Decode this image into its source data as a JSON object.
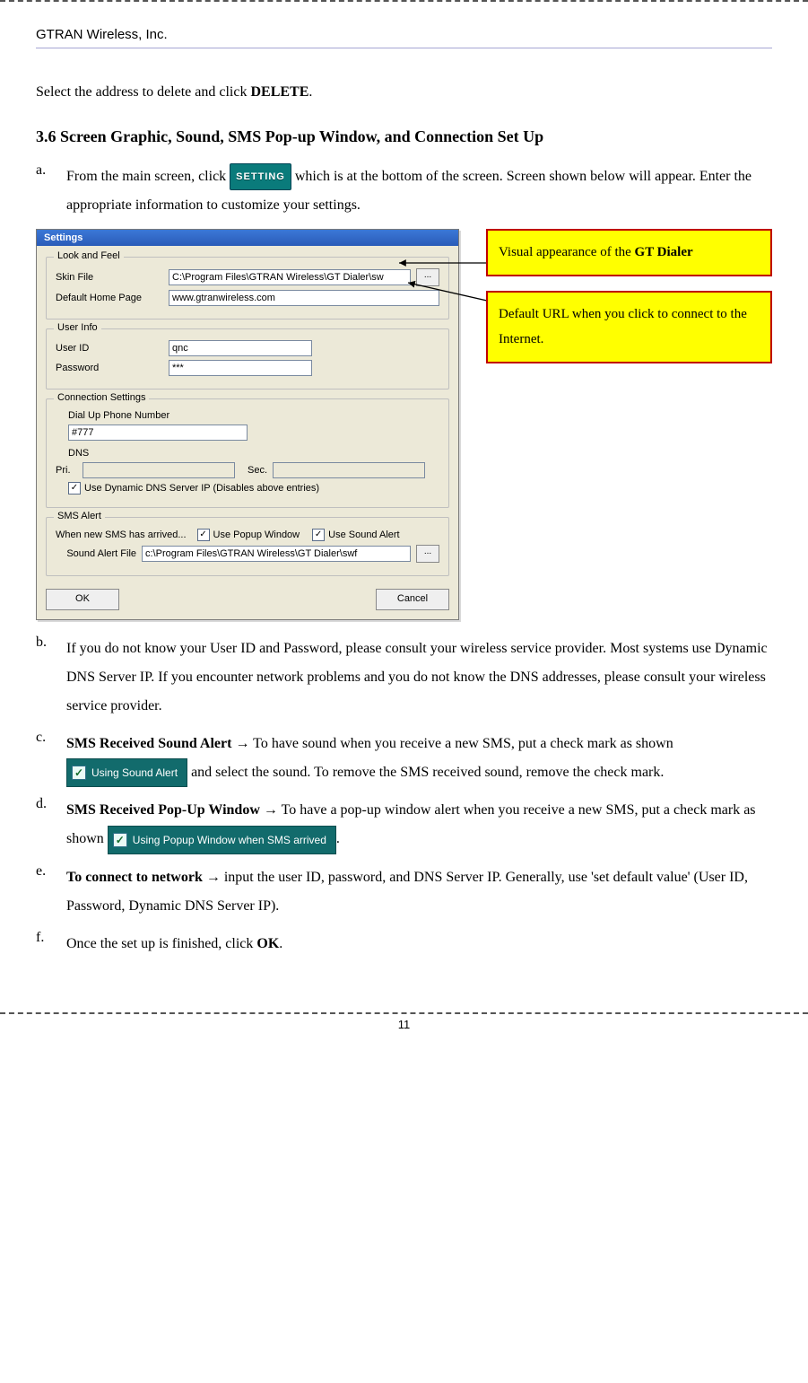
{
  "header": {
    "company": "GTRAN Wireless, Inc."
  },
  "intro": "Select the address to delete and click ",
  "intro_bold": "DELETE",
  "intro_tail": ".",
  "section_title": "3.6 Screen Graphic, Sound, SMS Pop-up Window, and Connection Set Up",
  "item_a": {
    "marker": "a.",
    "t1": "From the main screen, click ",
    "setting_btn": "SETTING",
    "t2": " which is at the bottom of the screen.    Screen shown below will appear. Enter the appropriate information to customize your settings."
  },
  "dialog": {
    "title": "Settings",
    "grp_look": "Look and Feel",
    "lbl_skin": "Skin File",
    "val_skin": "C:\\Program Files\\GTRAN Wireless\\GT Dialer\\sw",
    "lbl_home": "Default Home Page",
    "val_home": "www.gtranwireless.com",
    "browse": "...",
    "grp_user": "User Info",
    "lbl_userid": "User ID",
    "val_userid": "qnc",
    "lbl_pwd": "Password",
    "val_pwd": "***",
    "grp_conn": "Connection Settings",
    "lbl_dial": "Dial Up Phone Number",
    "val_dial": "#777",
    "lbl_dns": "DNS",
    "lbl_pri": "Pri.",
    "lbl_sec": "Sec.",
    "chk_dyn": "Use Dynamic DNS Server IP (Disables above entries)",
    "grp_sms": "SMS Alert",
    "sms_when": "When new SMS has arrived...",
    "chk_popup": "Use Popup Window",
    "chk_sound": "Use Sound Alert",
    "lbl_soundfile": "Sound Alert File",
    "val_soundfile": "c:\\Program Files\\GTRAN Wireless\\GT Dialer\\swf",
    "ok": "OK",
    "cancel": "Cancel"
  },
  "callout1_a": "Visual appearance of the ",
  "callout1_b": "GT Dialer",
  "callout2": "Default URL when you click to connect to the Internet.",
  "item_b": {
    "marker": "b.",
    "text": "If you do not know your User ID and Password, please consult your wireless service provider. Most systems use Dynamic DNS Server IP. If you encounter network problems and you do not know the DNS addresses, please consult your wireless service provider."
  },
  "item_c": {
    "marker": "c.",
    "b1": "SMS Received Sound Alert ",
    "arrow": "→",
    "t1": " To have sound when you receive a new SMS, put a check mark as shown ",
    "chip": "Using Sound Alert",
    "t2": " and select the sound. To remove the SMS received sound, remove the check mark."
  },
  "item_d": {
    "marker": "d.",
    "b1": "SMS Received Pop-Up Window ",
    "arrow": "→",
    "t1": " To have a pop-up window alert when you receive a new SMS, put a check mark as shown ",
    "chip": "Using Popup Window when SMS arrived",
    "t2": "."
  },
  "item_e": {
    "marker": "e.",
    "b1": "To connect to network ",
    "arrow": "→",
    "t1": " input the user ID, password, and DNS Server IP.    Generally, use 'set default value' (User ID, Password, Dynamic DNS Server IP)."
  },
  "item_f": {
    "marker": "f.",
    "t1": "Once the set up is finished, click ",
    "b1": "OK",
    "t2": "."
  },
  "page_number": "11"
}
